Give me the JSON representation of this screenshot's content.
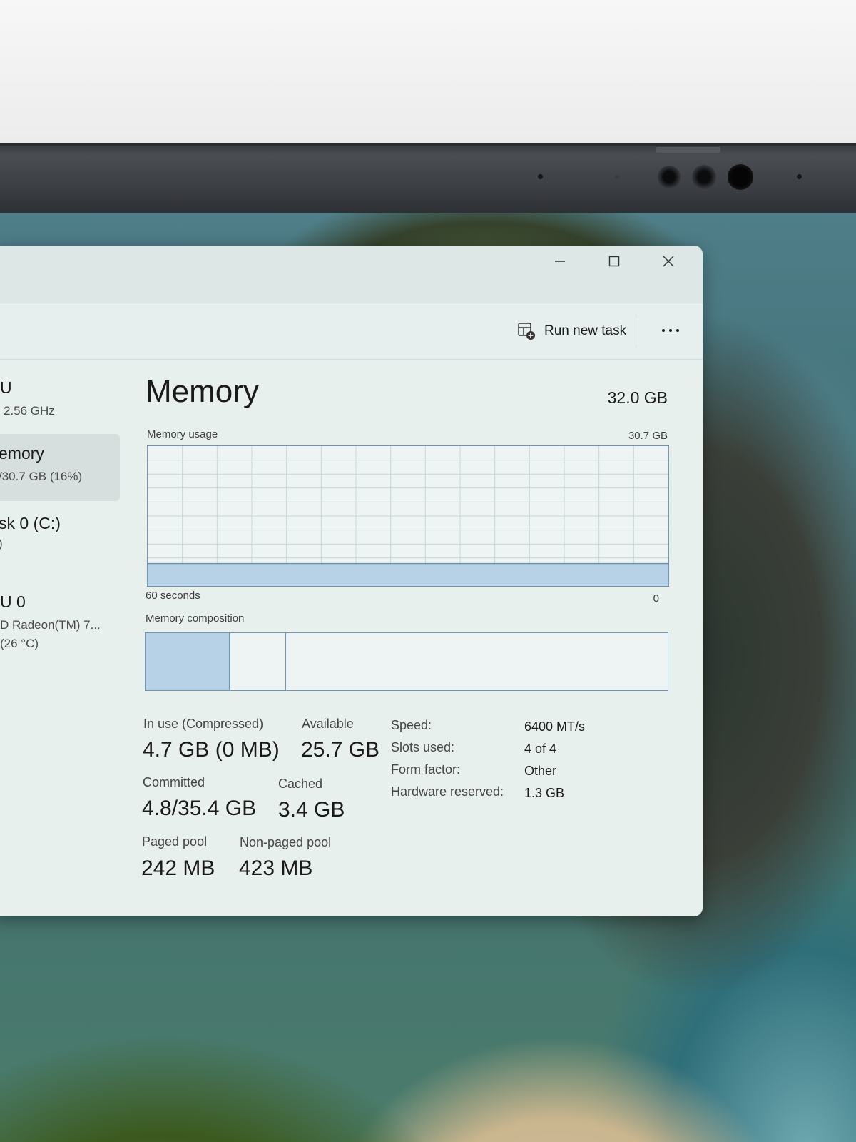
{
  "toolbar": {
    "run_new_task": "Run new task"
  },
  "sidebar": {
    "items": [
      {
        "title": "U",
        "subtitle": "2.56 GHz"
      },
      {
        "title": "emory",
        "subtitle": "/30.7 GB (16%)"
      },
      {
        "title": "sk 0 (C:)",
        "subtitle": ")"
      },
      {
        "title": "U 0",
        "subtitle": "D Radeon(TM) 7...",
        "subtitle2": "(26 °C)"
      }
    ]
  },
  "main": {
    "title": "Memory",
    "total": "32.0 GB",
    "usage_label": "Memory usage",
    "usage_max": "30.7 GB",
    "time_label": "60 seconds",
    "time_zero": "0",
    "composition_label": "Memory composition",
    "usage_fraction": 0.16,
    "composition": {
      "in_use_fraction": 0.16,
      "modified_fraction": 0.105
    },
    "stats": {
      "in_use_label": "In use (Compressed)",
      "in_use_value": "4.7 GB (0 MB)",
      "available_label": "Available",
      "available_value": "25.7 GB",
      "committed_label": "Committed",
      "committed_value": "4.8/35.4 GB",
      "cached_label": "Cached",
      "cached_value": "3.4 GB",
      "paged_label": "Paged pool",
      "paged_value": "242 MB",
      "nonpaged_label": "Non-paged pool",
      "nonpaged_value": "423 MB"
    },
    "specs": [
      {
        "label": "Speed:",
        "value": "6400 MT/s"
      },
      {
        "label": "Slots used:",
        "value": "4 of 4"
      },
      {
        "label": "Form factor:",
        "value": "Other"
      },
      {
        "label": "Hardware reserved:",
        "value": "1.3 GB"
      }
    ]
  },
  "colors": {
    "accent_fill": "#b7d2e6",
    "accent_border": "#6f95b3",
    "window_bg": "#e8f0ee"
  }
}
